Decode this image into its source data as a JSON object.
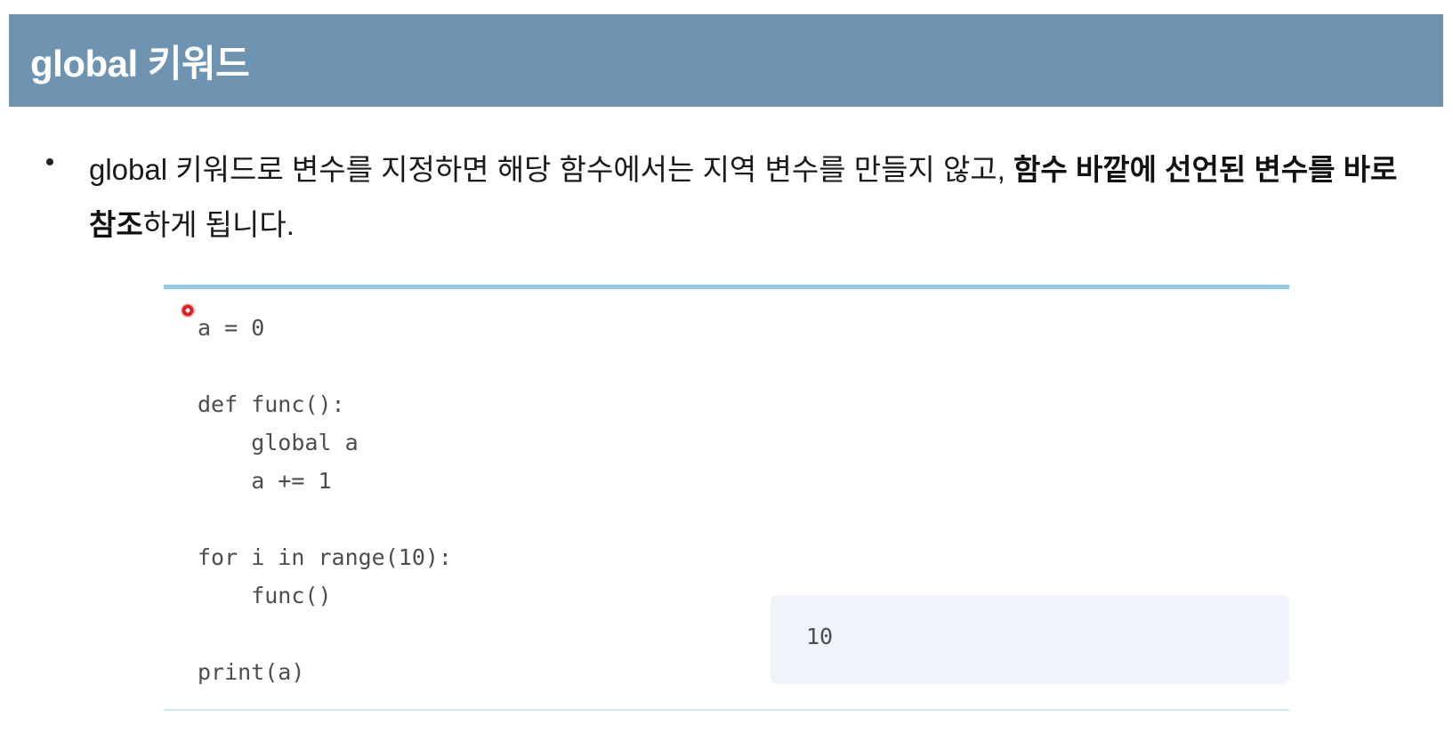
{
  "title": "global 키워드",
  "bullet": {
    "segments": [
      {
        "text": "global 키워드로 변수를 지정하면 해당 함수에서는 지역 변수를 만들지 않고, ",
        "bold": false
      },
      {
        "text": "함수 바깥에 선언된 변수를 바로 참조",
        "bold": true
      },
      {
        "text": "하게 됩니다.",
        "bold": false
      }
    ]
  },
  "code": {
    "lines": [
      "a = 0",
      "",
      "def func():",
      "    global a",
      "    a += 1",
      "",
      "for i in range(10):",
      "    func()",
      "",
      "print(a)"
    ]
  },
  "output": {
    "value": "10"
  },
  "colors": {
    "title_bar": "#6e94b1",
    "code_rule": "#8fcbe6",
    "output_bg": "#eef4fa",
    "cursor": "#e02020"
  },
  "icons": {
    "cursor": "mouse-pointer-indicator"
  }
}
